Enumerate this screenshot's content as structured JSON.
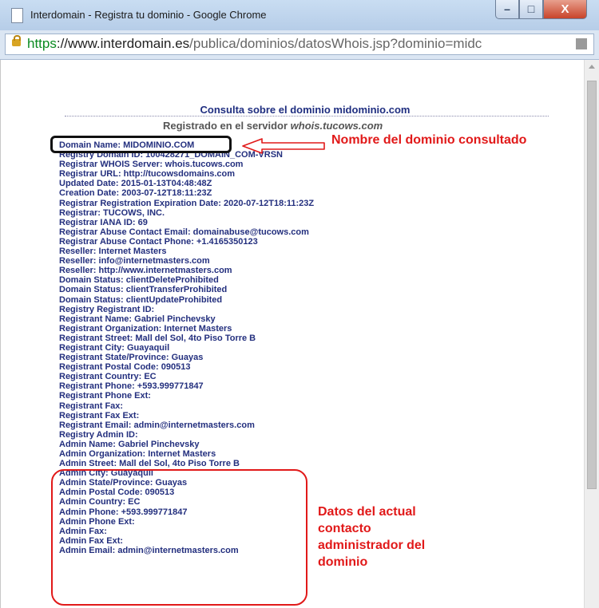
{
  "window": {
    "title": "Interdomain - Registra tu dominio - Google Chrome",
    "controls": {
      "minimize": "–",
      "maximize": "□",
      "close": "X"
    }
  },
  "address_bar": {
    "scheme": "https",
    "host": "://www.interdomain.es",
    "path": "/publica/dominios/datosWhois.jsp?dominio=midc"
  },
  "page": {
    "heading_prefix": "Consulta sobre el dominio ",
    "heading_domain": "midominio.com",
    "server_prefix": "Registrado en el servidor ",
    "server_name": "whois.tucows.com",
    "whois_lines": [
      "Domain Name: MIDOMINIO.COM",
      "Registry Domain ID: 100428271_DOMAIN_COM-VRSN",
      "Registrar WHOIS Server: whois.tucows.com",
      "Registrar URL: http://tucowsdomains.com",
      "Updated Date: 2015-01-13T04:48:48Z",
      "Creation Date: 2003-07-12T18:11:23Z",
      "Registrar Registration Expiration Date: 2020-07-12T18:11:23Z",
      "Registrar: TUCOWS, INC.",
      "Registrar IANA ID: 69",
      "Registrar Abuse Contact Email: domainabuse@tucows.com",
      "Registrar Abuse Contact Phone: +1.4165350123",
      "Reseller: Internet Masters",
      "Reseller: info@internetmasters.com",
      "Reseller: http://www.internetmasters.com",
      "Domain Status: clientDeleteProhibited",
      "Domain Status: clientTransferProhibited",
      "Domain Status: clientUpdateProhibited",
      "Registry Registrant ID:",
      "Registrant Name: Gabriel Pinchevsky",
      "Registrant Organization: Internet Masters",
      "Registrant Street: Mall del Sol, 4to Piso Torre B",
      "Registrant City: Guayaquil",
      "Registrant State/Province: Guayas",
      "Registrant Postal Code: 090513",
      "Registrant Country: EC",
      "Registrant Phone: +593.999771847",
      "Registrant Phone Ext:",
      "Registrant Fax:",
      "Registrant Fax Ext:",
      "Registrant Email: admin@internetmasters.com",
      "Registry Admin ID:",
      "Admin Name: Gabriel Pinchevsky",
      "Admin Organization: Internet Masters",
      "Admin Street: Mall del Sol, 4to Piso Torre B",
      "Admin City: Guayaquil",
      "Admin State/Province: Guayas",
      "Admin Postal Code: 090513",
      "Admin Country: EC",
      "Admin Phone: +593.999771847",
      "Admin Phone Ext:",
      "Admin Fax:",
      "Admin Fax Ext:",
      "Admin Email: admin@internetmasters.com"
    ]
  },
  "annotations": {
    "domain_note": "Nombre del dominio consultado",
    "admin_note_lines": [
      "Datos del actual",
      "contacto",
      "administrador del",
      "dominio"
    ],
    "color": "#e11919"
  },
  "colors": {
    "whois_text": "#232f7e",
    "heading": "#1f2e80",
    "url_scheme": "#0a8a20"
  }
}
